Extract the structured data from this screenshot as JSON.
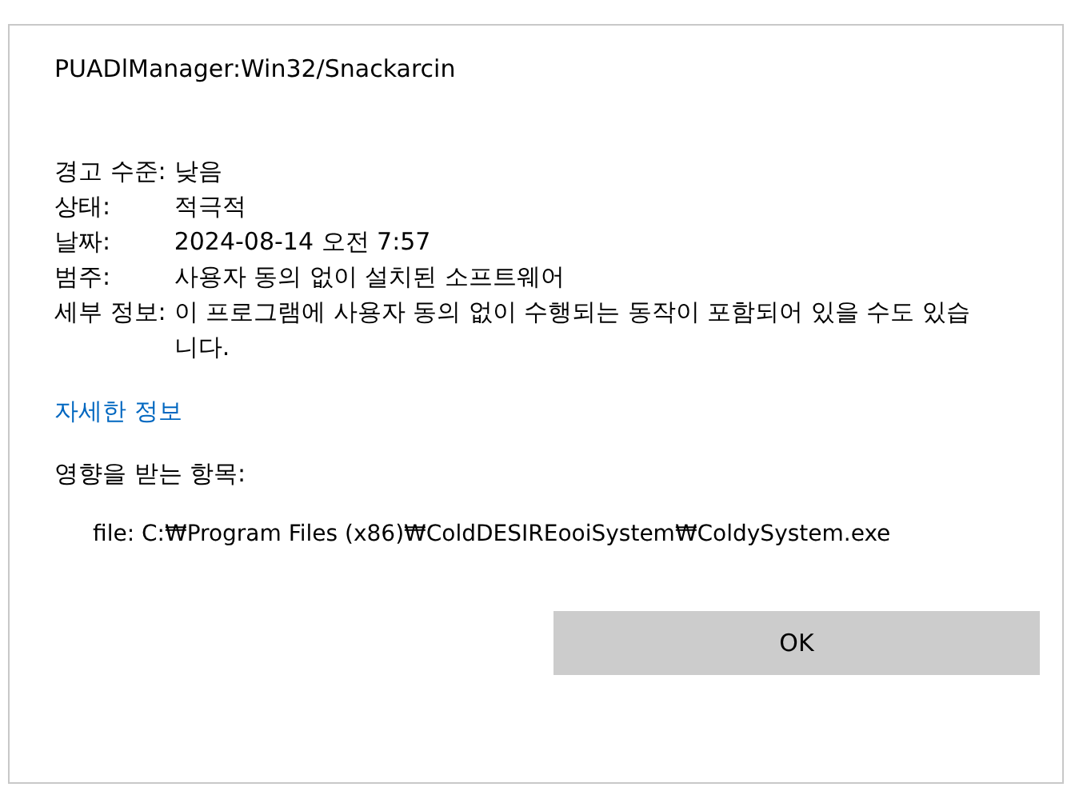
{
  "dialog": {
    "title": "PUADlManager:Win32/Snackarcin",
    "details": [
      {
        "label": "경고 수준:",
        "value": "낮음"
      },
      {
        "label": "상태:",
        "value": "적극적"
      },
      {
        "label": "날짜:",
        "value": "2024-08-14 오전 7:57"
      },
      {
        "label": "범주:",
        "value": "사용자 동의 없이 설치된 소프트웨어"
      },
      {
        "label": "세부 정보:",
        "value": "이 프로그램에 사용자 동의 없이 수행되는 동작이 포함되어 있을 수도 있습니다."
      }
    ],
    "link": "자세한 정보",
    "affected_heading": "영향을 받는 항목:",
    "affected_items": [
      "file: C:₩Program Files (x86)₩ColdDESIREooiSystem₩ColdySystem.exe"
    ],
    "buttons": [
      "OK"
    ]
  }
}
